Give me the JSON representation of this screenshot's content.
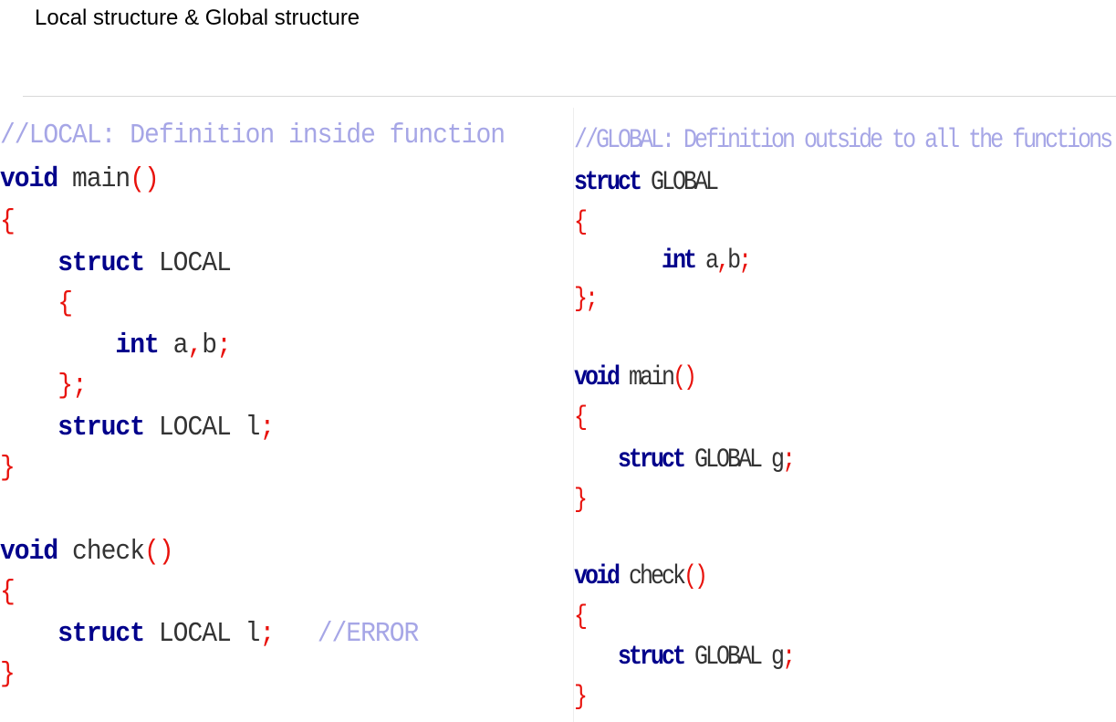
{
  "slide": {
    "title": "Local structure & Global structure"
  },
  "colors": {
    "keyword": "#00008b",
    "identifier": "#333333",
    "punctuation": "#e8120c",
    "comment": "#a6a6e6"
  },
  "local_panel": {
    "lines": [
      {
        "indent": "",
        "tokens": [
          {
            "t": "cm",
            "s": "//LOCAL: Definition inside function"
          }
        ]
      },
      {
        "indent": "",
        "tokens": [
          {
            "t": "kw",
            "s": "void"
          },
          {
            "t": "id",
            "s": " main"
          },
          {
            "t": "pn",
            "s": "()"
          }
        ]
      },
      {
        "indent": "",
        "tokens": [
          {
            "t": "pn",
            "s": "{"
          }
        ]
      },
      {
        "indent": "    ",
        "tokens": [
          {
            "t": "kw",
            "s": "struct"
          },
          {
            "t": "id",
            "s": " LOCAL"
          }
        ]
      },
      {
        "indent": "    ",
        "tokens": [
          {
            "t": "pn",
            "s": "{"
          }
        ]
      },
      {
        "indent": "        ",
        "tokens": [
          {
            "t": "kw",
            "s": "int"
          },
          {
            "t": "id",
            "s": " a"
          },
          {
            "t": "pn",
            "s": ","
          },
          {
            "t": "id",
            "s": "b"
          },
          {
            "t": "pn",
            "s": ";"
          }
        ]
      },
      {
        "indent": "    ",
        "tokens": [
          {
            "t": "pn",
            "s": "};"
          }
        ]
      },
      {
        "indent": "    ",
        "tokens": [
          {
            "t": "kw",
            "s": "struct"
          },
          {
            "t": "id",
            "s": " LOCAL l"
          },
          {
            "t": "pn",
            "s": ";"
          }
        ]
      },
      {
        "indent": "",
        "tokens": [
          {
            "t": "pn",
            "s": "}"
          }
        ]
      },
      {
        "indent": "",
        "tokens": []
      },
      {
        "indent": "",
        "tokens": [
          {
            "t": "kw",
            "s": "void"
          },
          {
            "t": "id",
            "s": " check"
          },
          {
            "t": "pn",
            "s": "()"
          }
        ]
      },
      {
        "indent": "",
        "tokens": [
          {
            "t": "pn",
            "s": "{"
          }
        ]
      },
      {
        "indent": "    ",
        "tokens": [
          {
            "t": "kw",
            "s": "struct"
          },
          {
            "t": "id",
            "s": " LOCAL l"
          },
          {
            "t": "pn",
            "s": ";"
          },
          {
            "t": "id",
            "s": "   "
          },
          {
            "t": "cm",
            "s": "//ERROR"
          }
        ]
      },
      {
        "indent": "",
        "tokens": [
          {
            "t": "pn",
            "s": "}"
          }
        ]
      }
    ]
  },
  "global_panel": {
    "lines": [
      {
        "indent": "",
        "tokens": [
          {
            "t": "cm",
            "s": "//GLOBAL: Definition outside to all the functions"
          }
        ]
      },
      {
        "indent": "",
        "tokens": [
          {
            "t": "kw",
            "s": "struct"
          },
          {
            "t": "id",
            "s": " GLOBAL"
          }
        ]
      },
      {
        "indent": "",
        "tokens": [
          {
            "t": "pn",
            "s": "{"
          }
        ]
      },
      {
        "indent": "        ",
        "tokens": [
          {
            "t": "kw",
            "s": "int"
          },
          {
            "t": "id",
            "s": " a"
          },
          {
            "t": "pn",
            "s": ","
          },
          {
            "t": "id",
            "s": "b"
          },
          {
            "t": "pn",
            "s": ";"
          }
        ]
      },
      {
        "indent": "",
        "tokens": [
          {
            "t": "pn",
            "s": "};"
          }
        ]
      },
      {
        "indent": "",
        "tokens": []
      },
      {
        "indent": "",
        "tokens": [
          {
            "t": "kw",
            "s": "void"
          },
          {
            "t": "id",
            "s": " main"
          },
          {
            "t": "pn",
            "s": "()"
          }
        ]
      },
      {
        "indent": "",
        "tokens": [
          {
            "t": "pn",
            "s": "{"
          }
        ]
      },
      {
        "indent": "    ",
        "tokens": [
          {
            "t": "kw",
            "s": "struct"
          },
          {
            "t": "id",
            "s": " GLOBAL g"
          },
          {
            "t": "pn",
            "s": ";"
          }
        ]
      },
      {
        "indent": "",
        "tokens": [
          {
            "t": "pn",
            "s": "}"
          }
        ]
      },
      {
        "indent": "",
        "tokens": []
      },
      {
        "indent": "",
        "tokens": [
          {
            "t": "kw",
            "s": "void"
          },
          {
            "t": "id",
            "s": " check"
          },
          {
            "t": "pn",
            "s": "()"
          }
        ]
      },
      {
        "indent": "",
        "tokens": [
          {
            "t": "pn",
            "s": "{"
          }
        ]
      },
      {
        "indent": "    ",
        "tokens": [
          {
            "t": "kw",
            "s": "struct"
          },
          {
            "t": "id",
            "s": " GLOBAL g"
          },
          {
            "t": "pn",
            "s": ";"
          }
        ]
      },
      {
        "indent": "",
        "tokens": [
          {
            "t": "pn",
            "s": "}"
          }
        ]
      }
    ]
  }
}
